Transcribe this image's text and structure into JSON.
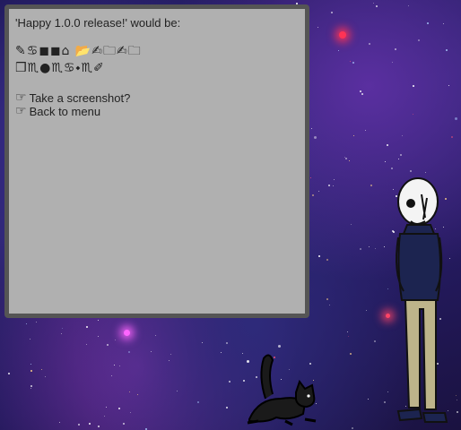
{
  "dialog": {
    "heading": "'Happy 1.0.0 release!' would be:",
    "glyph_line_1": "✎♋◼◼⌂ 📂✍🗀✍🗀",
    "glyph_line_2": "❒♏●♏♋⬩♏✐",
    "options": [
      {
        "icon": "pointing-hand-icon",
        "label": "Take a screenshot?"
      },
      {
        "icon": "pointing-hand-icon",
        "label": "Back to menu"
      }
    ],
    "pointer_glyph": "☞"
  },
  "scene": {
    "background": "starry-purple-space",
    "characters": [
      "skeleton-figure",
      "black-cat"
    ]
  },
  "colors": {
    "panel_bg": "#b0b0b0",
    "panel_border": "#555555",
    "text": "#222222"
  }
}
